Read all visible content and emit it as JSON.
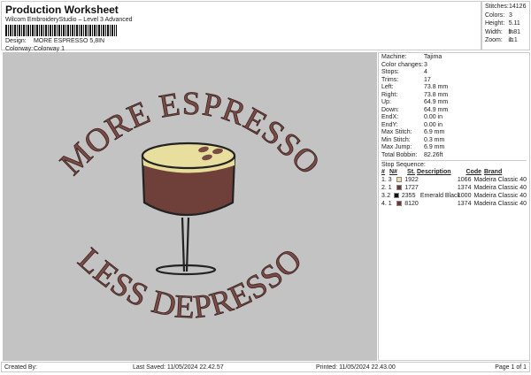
{
  "header": {
    "title": "Production Worksheet",
    "software": "Wilcom EmbroideryStudio – Level 3 Advanced",
    "design_label": "Design:",
    "design": "MORE ESPRESSO 5,8IN",
    "colorway_label": "Colorway:",
    "colorway": "Colorway 1"
  },
  "stats": [
    {
      "label": "Stitches:",
      "value": "14126"
    },
    {
      "label": "Colors:",
      "value": "3"
    },
    {
      "label": "Height:",
      "value": "5.11 in"
    },
    {
      "label": "Width:",
      "value": "5.81 in"
    },
    {
      "label": "Zoom:",
      "value": "1:1"
    }
  ],
  "design_text": {
    "top": "MORE ESPRESSO",
    "bottom": "LESS DEPRESSO"
  },
  "info": [
    {
      "label": "Machine:",
      "value": "Tajima"
    },
    {
      "label": "Color changes:",
      "value": "3"
    },
    {
      "label": "Stops:",
      "value": "4"
    },
    {
      "label": "Trims:",
      "value": "17"
    },
    {
      "label": "Left:",
      "value": "73.8 mm"
    },
    {
      "label": "Right:",
      "value": "73.8 mm"
    },
    {
      "label": "Up:",
      "value": "64.9 mm"
    },
    {
      "label": "Down:",
      "value": "64.9 mm"
    },
    {
      "label": "EndX:",
      "value": "0.00 in"
    },
    {
      "label": "EndY:",
      "value": "0.00 in"
    },
    {
      "label": "Max Stitch:",
      "value": "6.9 mm"
    },
    {
      "label": "Min Stitch:",
      "value": "0.3 mm"
    },
    {
      "label": "Max Jump:",
      "value": "6.9 mm"
    },
    {
      "label": "Total Bobbin:",
      "value": "82.26ft"
    }
  ],
  "stop_sequence": {
    "title": "Stop Sequence:",
    "headers": [
      "#",
      "N#",
      "St.",
      "Description",
      "Code",
      "Brand"
    ],
    "rows": [
      {
        "n": "1.",
        "needle": "3",
        "color": "#efdc9c",
        "st": "1922",
        "desc": "",
        "code": "1066",
        "brand": "Madeira Classic 40"
      },
      {
        "n": "2.",
        "needle": "1",
        "color": "#6e3336",
        "st": "1727",
        "desc": "",
        "code": "1374",
        "brand": "Madeira Classic 40"
      },
      {
        "n": "3.",
        "needle": "2",
        "color": "#111111",
        "st": "2355",
        "desc": "Emerald Black",
        "code": "1000",
        "brand": "Madeira Classic 40"
      },
      {
        "n": "4.",
        "needle": "1",
        "color": "#6e3336",
        "st": "8120",
        "desc": "",
        "code": "1374",
        "brand": "Madeira Classic 40"
      }
    ]
  },
  "footer": {
    "created_by": "Created By:",
    "last_saved": "Last Saved: 11/05/2024 22.42.57",
    "printed": "Printed: 11/05/2024 22.43.00",
    "page": "Page 1 of 1"
  }
}
